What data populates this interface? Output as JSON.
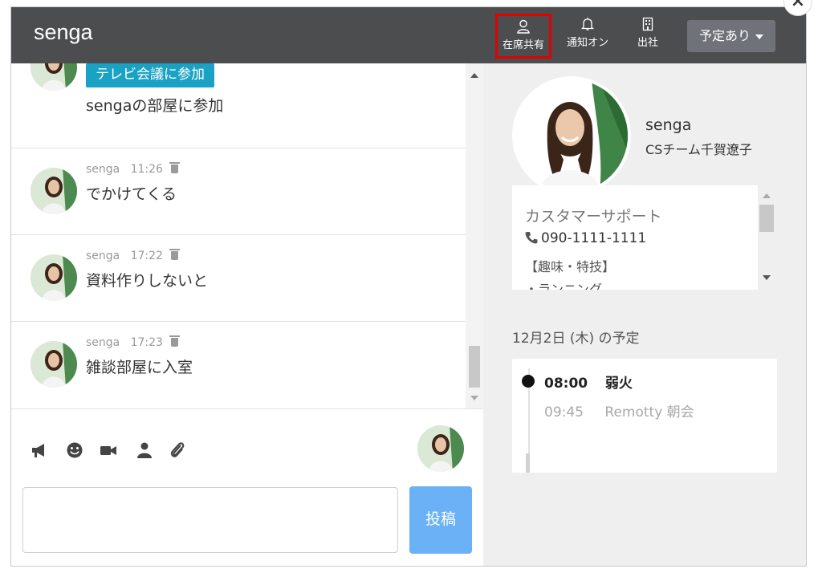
{
  "header": {
    "title": "senga",
    "buttons": [
      {
        "label": "在席共有",
        "icon": "person-icon",
        "highlighted": true
      },
      {
        "label": "通知オン",
        "icon": "bell-icon"
      },
      {
        "label": "出社",
        "icon": "building-icon"
      }
    ],
    "schedule_dropdown": "予定あり",
    "close_icon": "×"
  },
  "messages": [
    {
      "tv_button": "テレビ会議に参加",
      "text": "sengaの部屋に参加"
    },
    {
      "user": "senga",
      "time": "11:26",
      "text": "でかけてくる"
    },
    {
      "user": "senga",
      "time": "17:22",
      "text": "資料作りしないと"
    },
    {
      "user": "senga",
      "time": "17:23",
      "text": "雑談部屋に入室"
    }
  ],
  "toolbar": {
    "icons": [
      "megaphone-icon",
      "smiley-icon",
      "video-icon",
      "user-icon",
      "paperclip-icon"
    ],
    "post_label": "投稿",
    "compose_placeholder": ""
  },
  "profile": {
    "name": "senga",
    "team": "CSチーム千賀遼子",
    "department": "カスタマーサポート",
    "phone": "090-1111-1111",
    "hobby_heading": "【趣味・特技】",
    "hobby_item": "・ランニング"
  },
  "schedule": {
    "title": "12月2日 (木) の予定",
    "items": [
      {
        "time": "08:00",
        "label": "弱火",
        "active": true
      },
      {
        "time": "09:45",
        "label": "Remotty 朝会",
        "active": false
      }
    ]
  },
  "colors": {
    "header_bg": "#4b4d4f",
    "highlight": "#e30000",
    "tv_button": "#1aa2c4",
    "post_button": "#6ab1f5"
  }
}
